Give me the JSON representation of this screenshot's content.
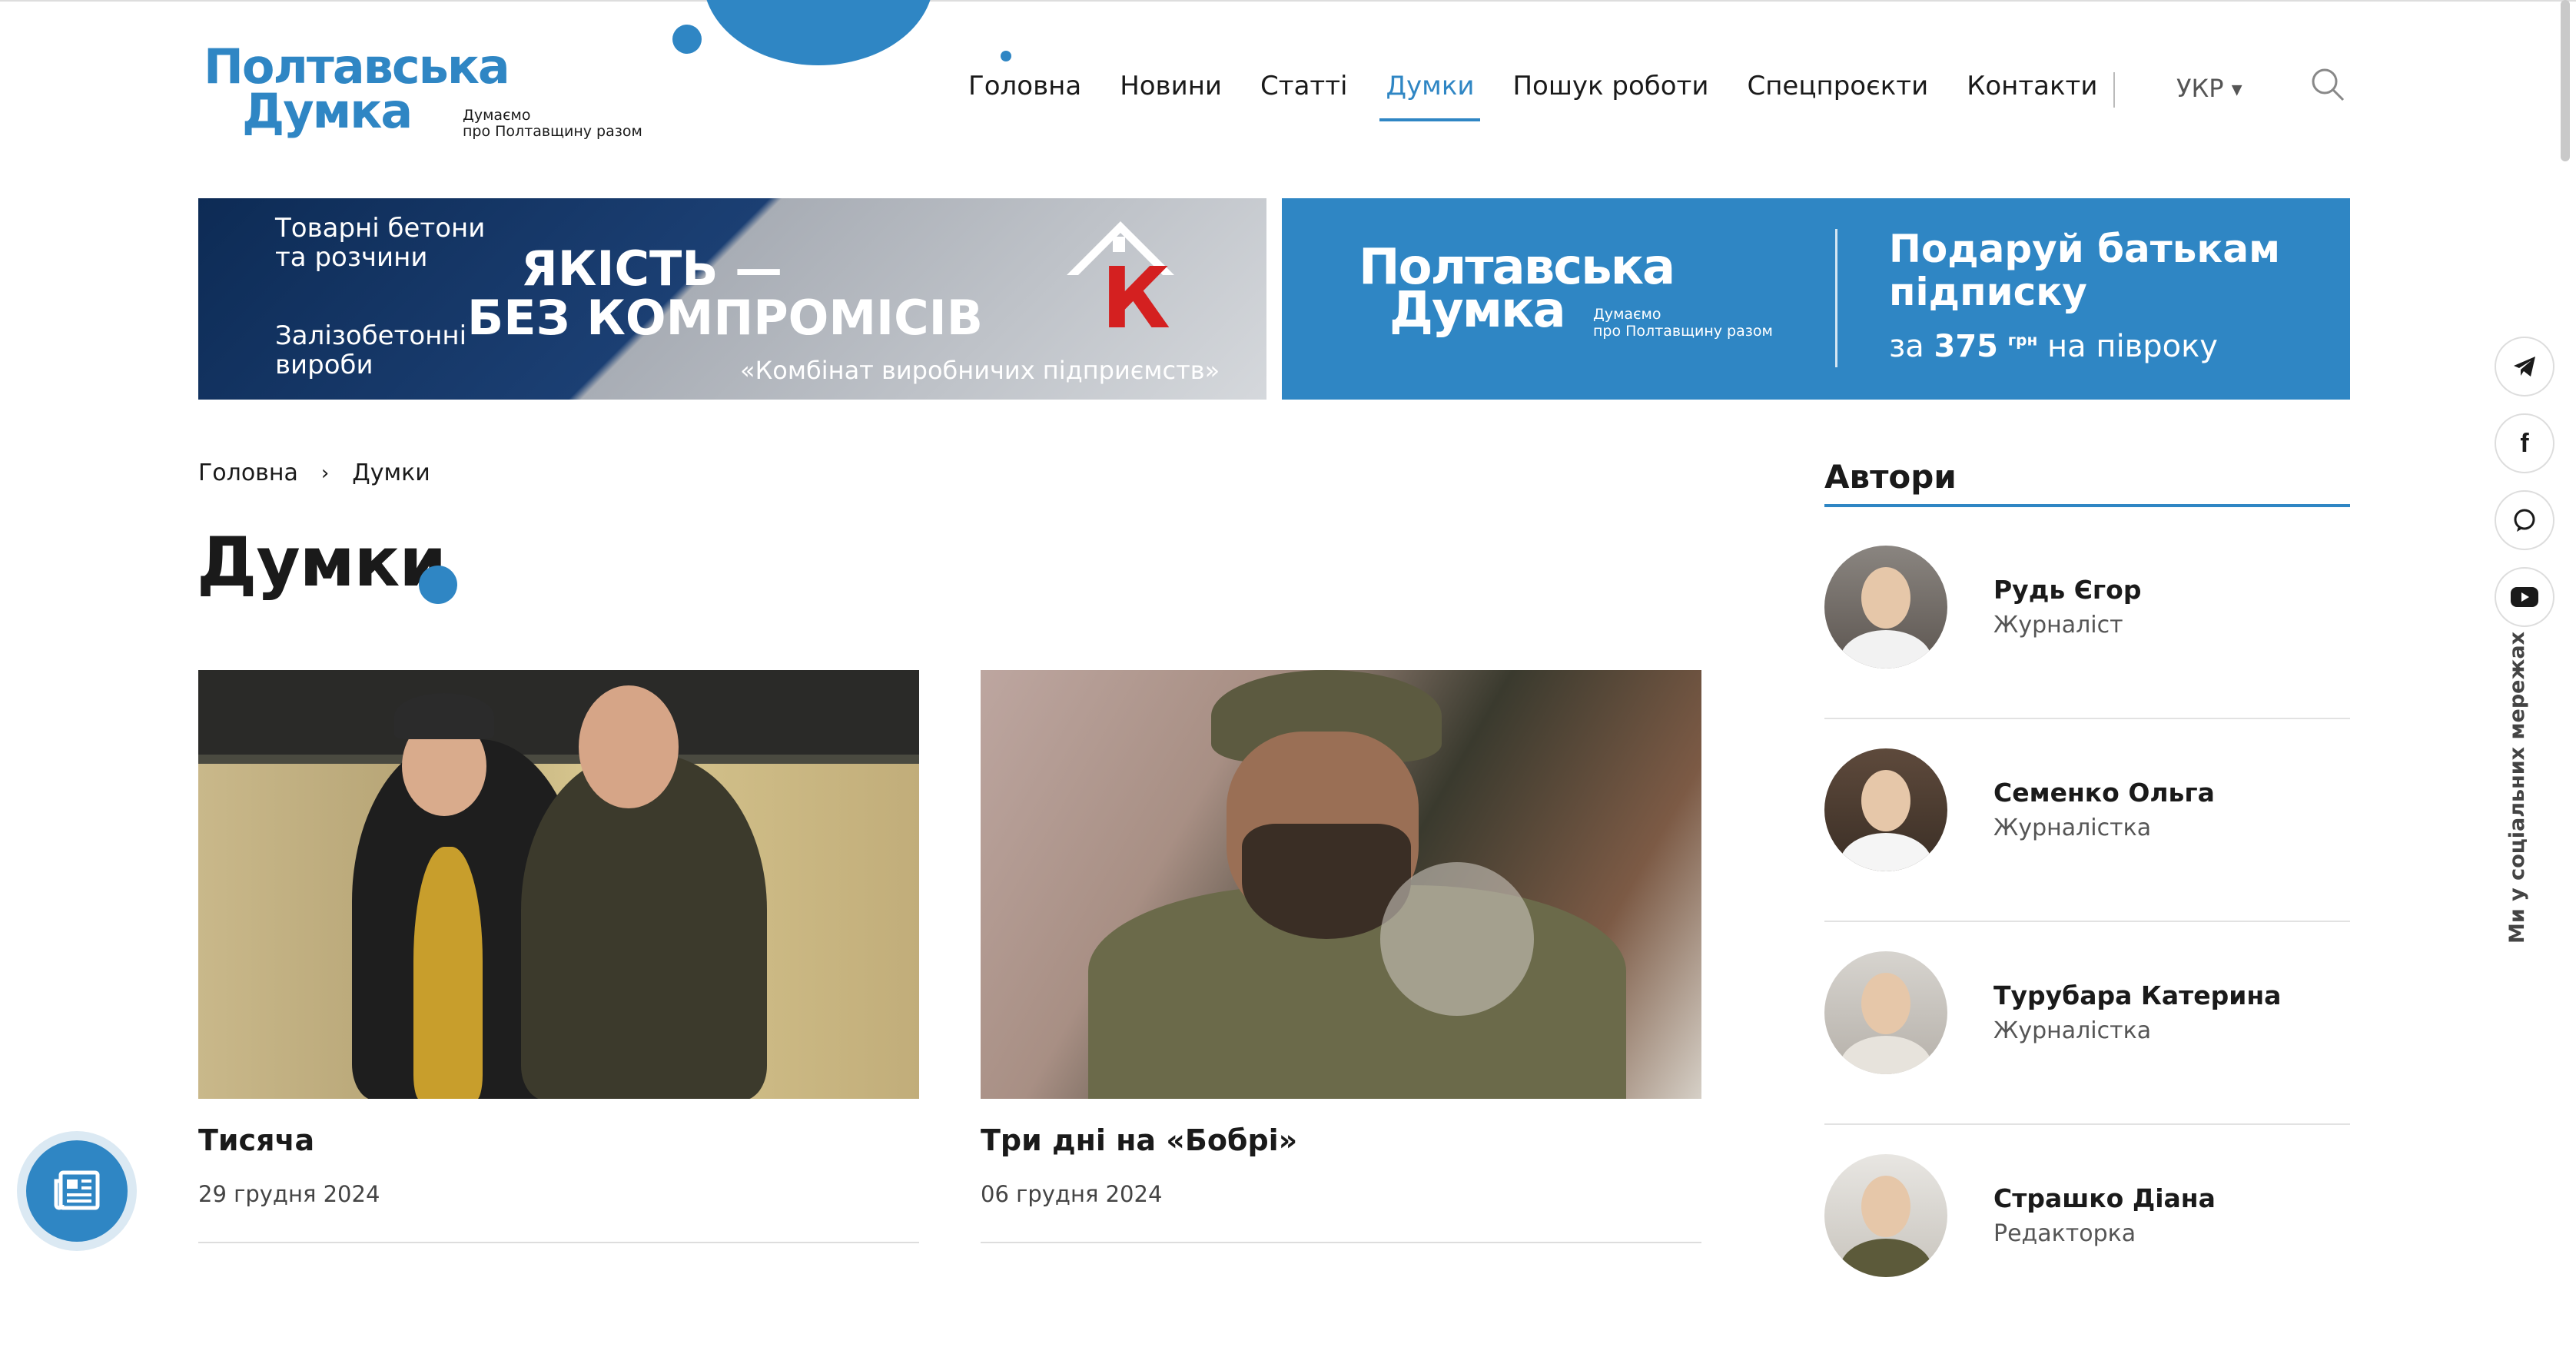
{
  "header": {
    "logo_line1": "Полтавська",
    "logo_line2": "Думка",
    "logo_tagline_1": "Думаємо",
    "logo_tagline_2": "про Полтавщину разом",
    "nav": [
      "Головна",
      "Новини",
      "Статті",
      "Думки",
      "Пошук роботи",
      "Спецпроєкти",
      "Контакти"
    ],
    "active_nav": "Думки",
    "language": "УКР",
    "search_icon": "search-icon"
  },
  "banners": {
    "left": {
      "line1a": "Товарні бетони",
      "line1b": "та розчини",
      "line2a": "Залізобетонні",
      "line2b": "вироби",
      "headline_1": "ЯКІСТЬ —",
      "headline_2": "БЕЗ КОМПРОМІСІВ",
      "sub": "«Комбінат виробничих підприємств»",
      "logo_letter": "К"
    },
    "right": {
      "logo_line1": "Полтавська",
      "logo_line2": "Думка",
      "tag_1": "Думаємо",
      "tag_2": "про Полтавщину разом",
      "head_1": "Подаруй батькам",
      "head_2": "підписку",
      "price_prefix": "за",
      "price": "375",
      "price_unit": "грн",
      "price_suffix": "на півроку"
    }
  },
  "breadcrumb": [
    "Головна",
    "Думки"
  ],
  "page_title": "Думки",
  "articles": [
    {
      "title": "Тисяча",
      "date": "29 грудня 2024"
    },
    {
      "title": "Три дні на «Бобрі»",
      "date": "06 грудня 2024"
    }
  ],
  "sidebar": {
    "title": "Автори",
    "authors": [
      {
        "name": "Рудь Єгор",
        "role": "Журналіст"
      },
      {
        "name": "Семенко Ольга",
        "role": "Журналістка"
      },
      {
        "name": "Турубара Катерина",
        "role": "Журналістка"
      },
      {
        "name": "Страшко Діана",
        "role": "Редакторка"
      }
    ]
  },
  "social": {
    "label": "Ми у соціальних мережах",
    "icons": [
      "telegram-icon",
      "facebook-icon",
      "viber-icon",
      "youtube-icon"
    ]
  },
  "colors": {
    "accent": "#2f86c4",
    "text": "#1a1a1a"
  }
}
